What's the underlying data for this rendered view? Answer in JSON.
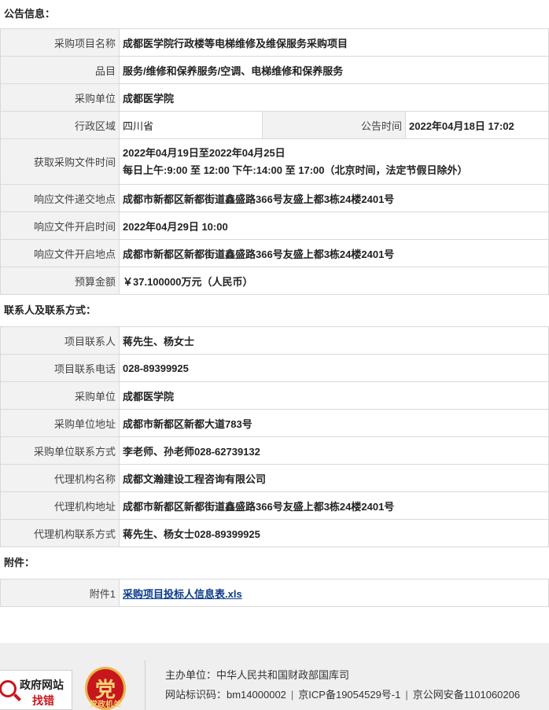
{
  "notice": {
    "heading": "公告信息：",
    "project_name_label": "采购项目名称",
    "project_name": "成都医学院行政楼等电梯维修及维保服务采购项目",
    "category_label": "品目",
    "category": "服务/维修和保养服务/空调、电梯维修和保养服务",
    "buyer_label": "采购单位",
    "buyer": "成都医学院",
    "region_label": "行政区域",
    "region": "四川省",
    "time_label": "公告时间",
    "time": "2022年04月18日  17:02",
    "obtain_label": "获取采购文件时间",
    "obtain_line1": "2022年04月19日至2022年04月25日",
    "obtain_line2": "每日上午:9:00 至 12:00  下午:14:00 至 17:00（北京时间，法定节假日除外）",
    "submit_place_label": "响应文件递交地点",
    "submit_place": "成都市新都区新都街道鑫盛路366号友盛上都3栋24楼2401号",
    "open_time_label": "响应文件开启时间",
    "open_time": "2022年04月29日 10:00",
    "open_place_label": "响应文件开启地点",
    "open_place": "成都市新都区新都街道鑫盛路366号友盛上都3栋24楼2401号",
    "budget_label": "预算金额",
    "budget": "￥37.100000万元（人民币）"
  },
  "contact": {
    "heading": "联系人及联系方式：",
    "project_contact_label": "项目联系人",
    "project_contact": "蒋先生、杨女士",
    "project_phone_label": "项目联系电话",
    "project_phone": "028-89399925",
    "buyer_label": "采购单位",
    "buyer": "成都医学院",
    "buyer_addr_label": "采购单位地址",
    "buyer_addr": "成都市新都区新都大道783号",
    "buyer_contact_label": "采购单位联系方式",
    "buyer_contact": "李老师、孙老师028-62739132",
    "agency_name_label": "代理机构名称",
    "agency_name": "成都文瀚建设工程咨询有限公司",
    "agency_addr_label": "代理机构地址",
    "agency_addr": "成都市新都区新都街道鑫盛路366号友盛上都3栋24楼2401号",
    "agency_contact_label": "代理机构联系方式",
    "agency_contact": "蒋先生、杨女士028-89399925"
  },
  "attachment": {
    "heading": "附件：",
    "item_label": "附件1",
    "item_link": "采购项目投标人信息表.xls"
  },
  "footer": {
    "gov_badge_line1": "政府网站",
    "gov_badge_line2": "找错",
    "party_badge_glyph": "党",
    "party_badge_label": "党政机关",
    "sponsor": "主办单位：中华人民共和国财政部国库司",
    "site_id": "网站标识码：bm14000002",
    "icp": "京ICP备19054529号-1",
    "police": "京公网安备1101060206"
  },
  "colors": {
    "label_bg": "#f2f2f2",
    "border": "#d9d9d9",
    "link": "#0b3a8c",
    "badge_red": "#c8161d"
  }
}
